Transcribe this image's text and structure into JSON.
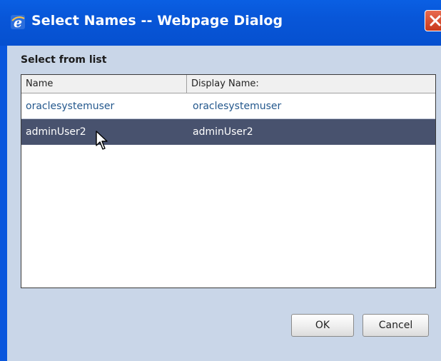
{
  "window": {
    "title": "Select Names -- Webpage Dialog",
    "app_icon": "ie-icon",
    "close_icon": "close-icon",
    "colors": {
      "titlebar": "#0a57dd",
      "client": "#c9d6e8",
      "close": "#d9502f"
    }
  },
  "dialog": {
    "section_label": "Select from list",
    "columns": [
      "Name",
      "Display Name:"
    ],
    "rows": [
      {
        "name": "oraclesystemuser",
        "display_name": "oraclesystemuser",
        "selected": false
      },
      {
        "name": "adminUser2",
        "display_name": "adminUser2",
        "selected": true
      }
    ],
    "colors": {
      "selected_row": "#48526e",
      "row_text": "#24588d"
    }
  },
  "buttons": {
    "ok_label": "OK",
    "cancel_label": "Cancel"
  }
}
